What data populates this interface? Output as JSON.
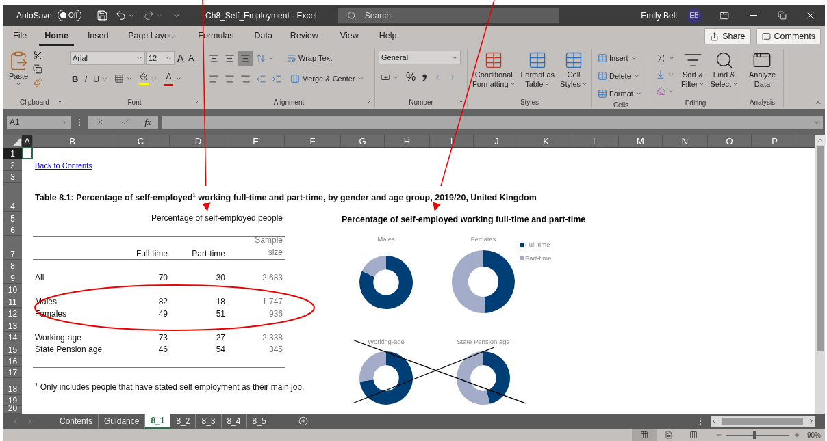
{
  "title_bar": {
    "autosave": {
      "label": "AutoSave",
      "state_text": "Off",
      "on": false
    },
    "document_title": "Ch8_Self_Employment  -  Excel",
    "search_placeholder": "Search",
    "user_name": "Emily Bell",
    "user_initials": "EB"
  },
  "menu_tabs": [
    {
      "label": "File",
      "selected": false
    },
    {
      "label": "Home",
      "selected": true
    },
    {
      "label": "Insert",
      "selected": false
    },
    {
      "label": "Page Layout",
      "selected": false
    },
    {
      "label": "Formulas",
      "selected": false
    },
    {
      "label": "Data",
      "selected": false
    },
    {
      "label": "Review",
      "selected": false
    },
    {
      "label": "View",
      "selected": false
    },
    {
      "label": "Help",
      "selected": false
    }
  ],
  "share_button": "Share",
  "comments_button": "Comments",
  "ribbon_groups": [
    {
      "kind": "clipboard",
      "label": "Clipboard",
      "paste": "Paste"
    },
    {
      "kind": "font",
      "label": "Font",
      "font_name": "Arial",
      "font_size": "12",
      "grow": "A",
      "shrink": "A",
      "bold": "B",
      "italic": "I",
      "underline": "U",
      "font_color": "A"
    },
    {
      "kind": "alignment",
      "label": "Alignment",
      "vertical_align": [
        {
          "selected": false
        },
        {
          "selected": false
        },
        {
          "selected": true
        }
      ],
      "wrap_text": "Wrap Text",
      "merge_center": "Merge & Center"
    },
    {
      "kind": "number",
      "label": "Number",
      "format": "General",
      "percent": "%"
    },
    {
      "kind": "styles",
      "label": "Styles",
      "buttons": [
        {
          "lines": [
            "Conditional",
            "Formatting"
          ]
        },
        {
          "lines": [
            "Format as",
            "Table"
          ]
        },
        {
          "lines": [
            "Cell",
            "Styles"
          ]
        }
      ]
    },
    {
      "kind": "cells",
      "label": "Cells",
      "buttons": [
        "Insert",
        "Delete",
        "Format"
      ]
    },
    {
      "kind": "editing",
      "label": "Editing",
      "buttons": [
        {
          "lines": [
            "Sort &",
            "Filter"
          ]
        },
        {
          "lines": [
            "Find &",
            "Select"
          ]
        }
      ]
    },
    {
      "kind": "analysis",
      "label": "Analysis",
      "buttons": [
        {
          "lines": [
            "Analyze",
            "Data"
          ]
        }
      ]
    }
  ],
  "formula_bar": {
    "name_box": "A1",
    "function_label": "fx"
  },
  "columns": [
    {
      "label": "A",
      "selected": true
    },
    {
      "label": "B",
      "selected": false
    },
    {
      "label": "C",
      "selected": false
    },
    {
      "label": "D",
      "selected": false
    },
    {
      "label": "E",
      "selected": false
    },
    {
      "label": "F",
      "selected": false
    },
    {
      "label": "G",
      "selected": false
    },
    {
      "label": "H",
      "selected": false
    },
    {
      "label": "I",
      "selected": false
    },
    {
      "label": "J",
      "selected": false
    },
    {
      "label": "K",
      "selected": false
    },
    {
      "label": "L",
      "selected": false
    },
    {
      "label": "M",
      "selected": false
    },
    {
      "label": "N",
      "selected": false
    },
    {
      "label": "O",
      "selected": false
    },
    {
      "label": "P",
      "selected": false
    }
  ],
  "rows": [
    {
      "label": "1",
      "selected": true
    },
    {
      "label": "2",
      "selected": false
    },
    {
      "label": "3",
      "selected": false
    },
    {
      "label": "4",
      "selected": false
    },
    {
      "label": "5",
      "selected": false
    },
    {
      "label": "6",
      "selected": false
    },
    {
      "label": "7",
      "selected": false
    },
    {
      "label": "8",
      "selected": false
    },
    {
      "label": "9",
      "selected": false
    },
    {
      "label": "10",
      "selected": false
    },
    {
      "label": "11",
      "selected": false
    },
    {
      "label": "12",
      "selected": false
    },
    {
      "label": "13",
      "selected": false
    },
    {
      "label": "14",
      "selected": false
    },
    {
      "label": "15",
      "selected": false
    },
    {
      "label": "16",
      "selected": false
    },
    {
      "label": "17",
      "selected": false
    },
    {
      "label": "18",
      "selected": false
    },
    {
      "label": "19",
      "selected": false
    },
    {
      "label": "20",
      "selected": false
    }
  ],
  "sheet": {
    "back_link": "Back to Contents",
    "table_title": "Table 8.1: Percentage of self-employed$^{1}$ working full-time and part-time, by gender and age group, 2019/20, United Kingdom",
    "header_span": "Percentage of self-employed people",
    "table_columns": [
      "Full-time",
      "Part-time",
      "Sample size"
    ],
    "row_groups": [
      [
        {
          "label": "All",
          "full_time": "70",
          "part_time": "30",
          "sample_size": "2,683"
        }
      ],
      [
        {
          "label": "Males",
          "full_time": "82",
          "part_time": "18",
          "sample_size": "1,747"
        },
        {
          "label": "Females",
          "full_time": "49",
          "part_time": "51",
          "sample_size": "936"
        }
      ],
      [
        {
          "label": "Working-age",
          "full_time": "73",
          "part_time": "27",
          "sample_size": "2,338"
        },
        {
          "label": "State Pension age",
          "full_time": "46",
          "part_time": "54",
          "sample_size": "345"
        }
      ]
    ],
    "footnote": "$^{1}$ Only includes people that have stated self employment as their main job."
  },
  "chart": {
    "title": "Percentage of self-employed working full-time and part-time",
    "legend": [
      {
        "name": "Full-time",
        "color": "#003f75"
      },
      {
        "name": "Part-time",
        "color": "#a3adca"
      }
    ],
    "panels": [
      {
        "title": "Males"
      },
      {
        "title": "Females"
      },
      {
        "title": "Working-age"
      },
      {
        "title": "State Pension age"
      }
    ]
  },
  "sheet_tabs": [
    {
      "label": "Contents",
      "selected": false
    },
    {
      "label": "Guidance",
      "selected": false
    },
    {
      "label": "8_1",
      "selected": true
    },
    {
      "label": "8_2",
      "selected": false
    },
    {
      "label": "8_3",
      "selected": false
    },
    {
      "label": "8_4",
      "selected": false
    },
    {
      "label": "8_5",
      "selected": false
    }
  ],
  "status_bar": {
    "views": [
      {
        "selected": true
      },
      {
        "selected": false
      },
      {
        "selected": false
      }
    ],
    "zoom": {
      "level": 0.45,
      "reading": "90%"
    }
  }
}
